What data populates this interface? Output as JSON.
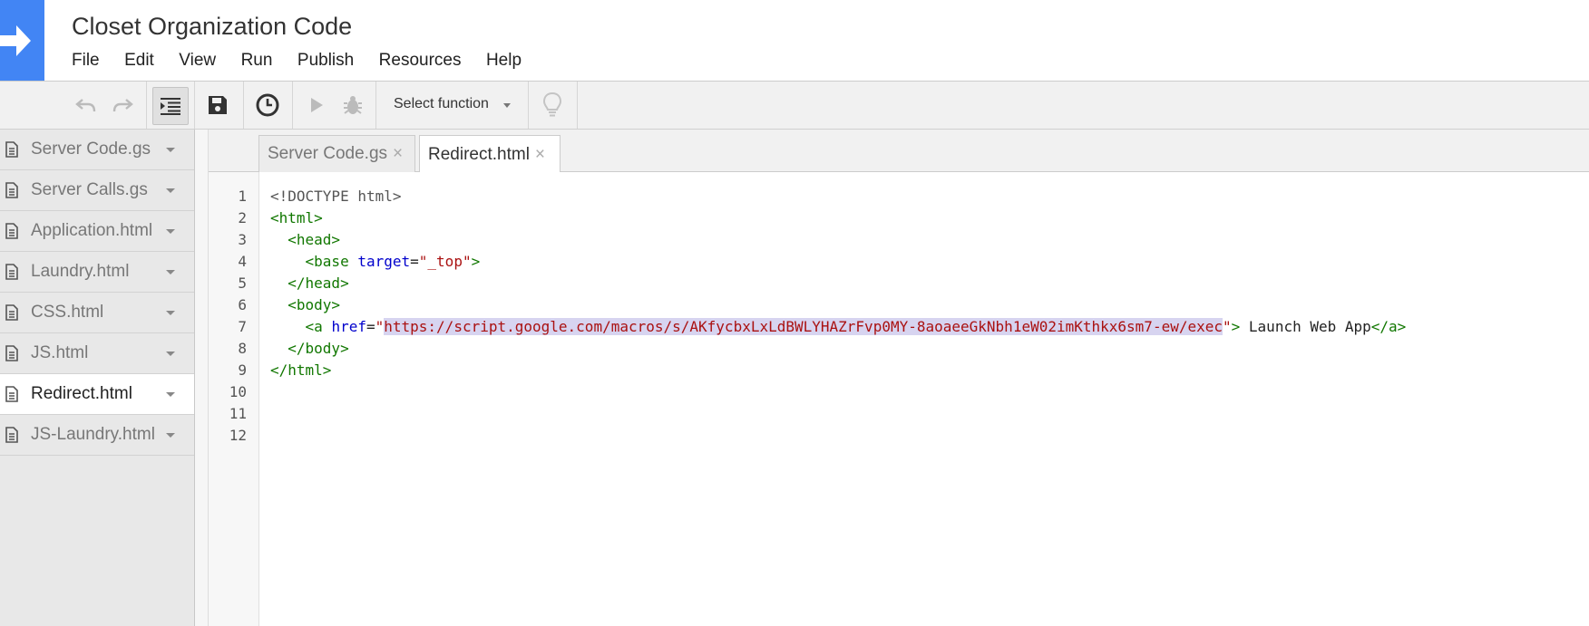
{
  "app": {
    "title": "Closet Organization Code"
  },
  "menu": [
    "File",
    "Edit",
    "View",
    "Run",
    "Publish",
    "Resources",
    "Help"
  ],
  "toolbar": {
    "select_function_label": "Select function"
  },
  "files": [
    {
      "name": "Server Code.gs",
      "active": false
    },
    {
      "name": "Server Calls.gs",
      "active": false
    },
    {
      "name": "Application.html",
      "active": false
    },
    {
      "name": "Laundry.html",
      "active": false
    },
    {
      "name": "CSS.html",
      "active": false
    },
    {
      "name": "JS.html",
      "active": false
    },
    {
      "name": "Redirect.html",
      "active": true
    },
    {
      "name": "JS-Laundry.html",
      "active": false
    }
  ],
  "tabs": [
    {
      "label": "Server Code.gs",
      "close": "×",
      "active": false
    },
    {
      "label": "Redirect.html",
      "close": "×",
      "active": true
    }
  ],
  "editor": {
    "line_numbers": [
      "1",
      "2",
      "3",
      "4",
      "5",
      "6",
      "7",
      "8",
      "9",
      "10",
      "11",
      "12"
    ],
    "code": {
      "l1": "<!DOCTYPE html>",
      "l2_tag": "<html>",
      "l3_tag": "<head>",
      "l4_tag_open": "<base",
      "l4_attr": "target",
      "l4_eq": "=",
      "l4_val": "\"_top\"",
      "l4_tag_close": ">",
      "l5_tag": "</head>",
      "l6_tag": "<body>",
      "l7_tag_open": "<a",
      "l7_attr": "href",
      "l7_eq": "=",
      "l7_q1": "\"",
      "l7_url": "https://script.google.com/macros/s/AKfycbxLxLdBWLYHAZrFvp0MY-8aoaeeGkNbh1eW02imKthkx6sm7-ew/exec",
      "l7_q2": "\"",
      "l7_gt": ">",
      "l7_text": " Launch Web App",
      "l7_close": "</a>",
      "l8_tag": "</body>",
      "l9_tag": "</html>"
    }
  }
}
